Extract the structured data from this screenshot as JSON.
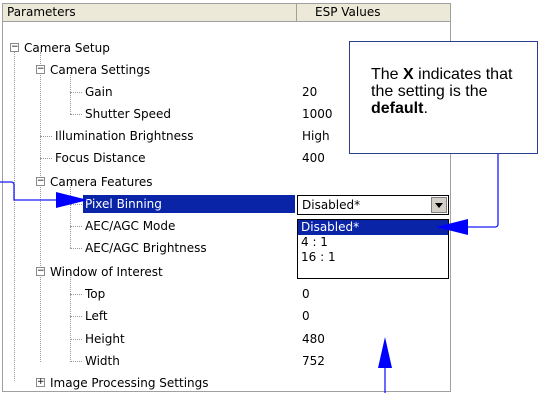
{
  "header": {
    "col_parameters": "Parameters",
    "col_values": "ESP Values"
  },
  "tree": {
    "camera_setup": "Camera Setup",
    "camera_settings": "Camera Settings",
    "gain": {
      "label": "Gain",
      "value": "20"
    },
    "shutter_speed": {
      "label": "Shutter Speed",
      "value": "1000"
    },
    "illumination_brightness": {
      "label": "Illumination Brightness",
      "value": "High"
    },
    "focus_distance": {
      "label": "Focus Distance",
      "value": "400"
    },
    "camera_features": "Camera Features",
    "pixel_binning": {
      "label": "Pixel Binning"
    },
    "aec_agc_mode": {
      "label": "AEC/AGC Mode"
    },
    "aec_agc_brightness": {
      "label": "AEC/AGC Brightness"
    },
    "window_of_interest": "Window of Interest",
    "top": {
      "label": "Top",
      "value": "0"
    },
    "left": {
      "label": "Left",
      "value": "0"
    },
    "height": {
      "label": "Height",
      "value": "480"
    },
    "width": {
      "label": "Width",
      "value": "752"
    },
    "image_processing_settings": "Image Processing Settings"
  },
  "dropdown": {
    "selected": "Disabled*",
    "options": [
      "Disabled*",
      "4 : 1",
      "16 : 1"
    ]
  },
  "callout": {
    "pre": "The ",
    "x": "X",
    "mid": " indicates that the setting is the ",
    "default": "default",
    "end": "."
  },
  "colors": {
    "selection": "#0a24a8",
    "arrow": "#0000ff",
    "callout_border": "#2a3f8f"
  }
}
